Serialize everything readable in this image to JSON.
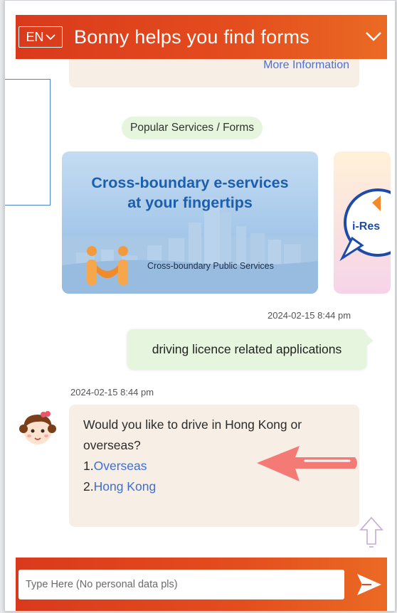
{
  "header": {
    "lang_label": "EN",
    "title": "Bonny helps you find forms"
  },
  "previous_message": {
    "link": "More Information"
  },
  "popular": {
    "label": "Popular Services / Forms"
  },
  "banners": [
    {
      "title_line1": "Cross-boundary e-services",
      "title_line2": "at your fingertips",
      "subtitle": "Cross-boundary Public Services"
    },
    {
      "badge_text": "i-Res"
    }
  ],
  "messages": [
    {
      "sender": "user",
      "timestamp": "2024-02-15 8:44 pm",
      "text": "driving licence related applications"
    },
    {
      "sender": "bot",
      "timestamp": "2024-02-15 8:44 pm",
      "text": "Would you like to drive in Hong Kong or overseas?",
      "options": [
        {
          "number": "1.",
          "label": "Overseas"
        },
        {
          "number": "2.",
          "label": "Hong Kong"
        }
      ]
    }
  ],
  "composer": {
    "placeholder": "Type Here (No personal data pls)"
  },
  "colors": {
    "brand": "#e44d1e",
    "user_bubble": "#e6f5dd",
    "bot_bubble": "#f7efe6",
    "link": "#3a6fd8"
  }
}
